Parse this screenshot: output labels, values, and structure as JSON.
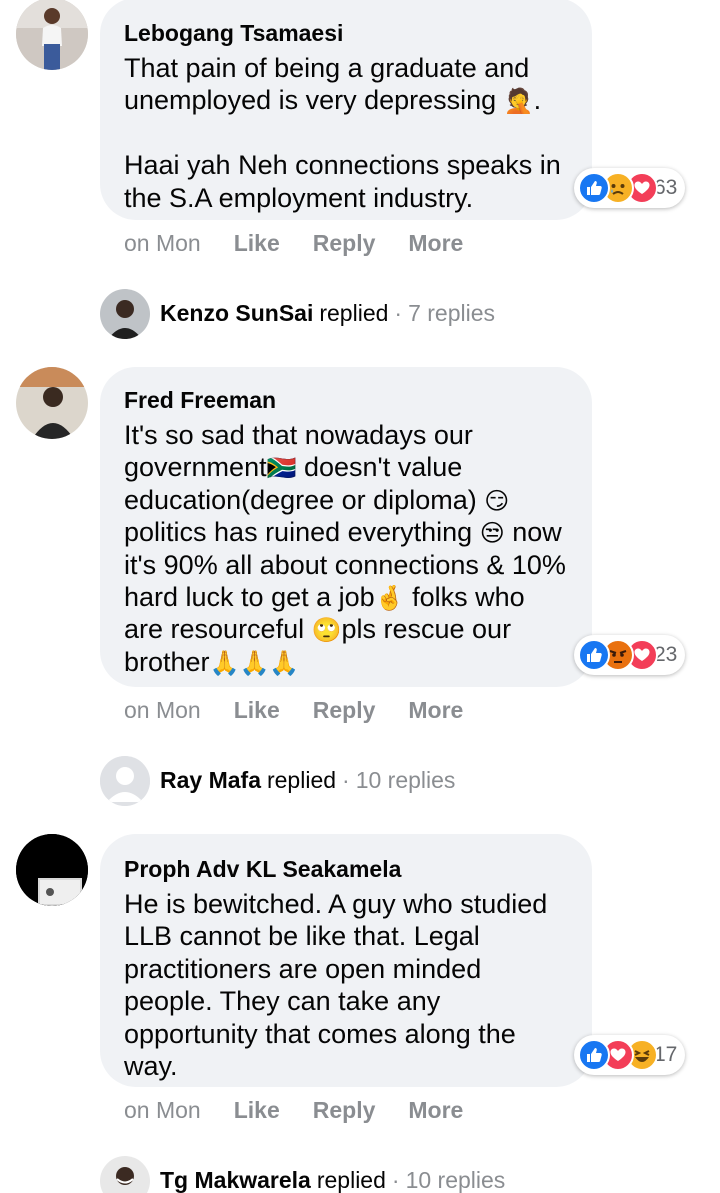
{
  "comments": [
    {
      "author": "Lebogang Tsamaesi",
      "text": "That pain of being a graduate and unemployed is very depressing ",
      "text_emoji": "🤦",
      "text_end": ".\n\nHaai yah Neh connections speaks in the S.A employment industry.",
      "reactions": {
        "icons": [
          "like-icon",
          "sad-icon",
          "love-icon"
        ],
        "count": "63"
      },
      "time": "on Mon",
      "actions": [
        "Like",
        "Reply",
        "More"
      ],
      "reply": {
        "name": "Kenzo SunSai",
        "verb": "replied",
        "dot": "·",
        "count": "7 replies"
      }
    },
    {
      "author": "Fred Freeman",
      "text_parts": [
        "It's so sad that nowadays our government",
        "🇿🇦",
        " doesn't value education(degree or diploma) ",
        "😏",
        " politics has ruined everything ",
        "😒",
        " now it's 90% all about connections & 10% hard luck to get a job",
        "🤞",
        " folks who are resourceful ",
        "🙄",
        "pls rescue our brother",
        "🙏🙏🙏"
      ],
      "reactions": {
        "icons": [
          "like-icon",
          "angry-icon",
          "love-icon"
        ],
        "count": "23"
      },
      "time": "on Mon",
      "actions": [
        "Like",
        "Reply",
        "More"
      ],
      "reply": {
        "name": "Ray Mafa",
        "verb": "replied",
        "dot": "·",
        "count": "10 replies"
      }
    },
    {
      "author": "Proph Adv KL Seakamela",
      "text": "He is bewitched. A guy who studied LLB cannot be like that. Legal practitioners are open minded people. They can take any opportunity that comes along the way.",
      "reactions": {
        "icons": [
          "like-icon",
          "love-icon",
          "haha-icon"
        ],
        "count": "17"
      },
      "time": "on Mon",
      "actions": [
        "Like",
        "Reply",
        "More"
      ],
      "reply": {
        "name": "Tg Makwarela",
        "verb": "replied",
        "dot": "·",
        "count": "10 replies"
      }
    }
  ],
  "colors": {
    "bubble": "#f0f2f5",
    "muted": "#8a8d91",
    "like": "#1877f2",
    "love": "#f33e58",
    "angry": "#e9710f",
    "reaction_yellow": "#f7b125"
  }
}
